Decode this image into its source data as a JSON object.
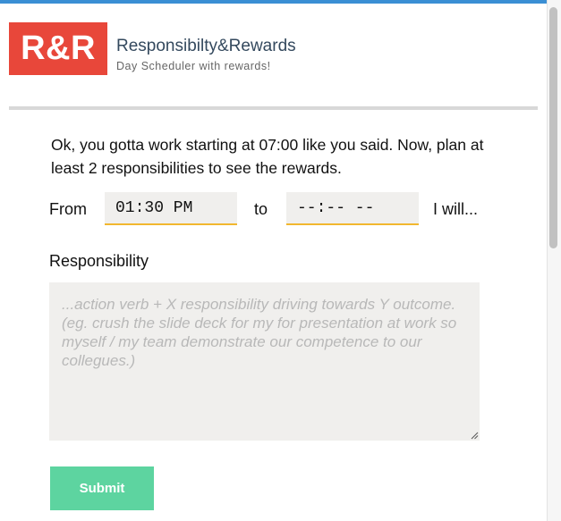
{
  "header": {
    "logo_text": "R&R",
    "title": "Responsibilty&Rewards",
    "subtitle": "Day Scheduler with rewards!",
    "logo_color": "#e8473a",
    "accent_color": "#3a8fd4"
  },
  "main": {
    "instructions": "Ok, you gotta work starting at 07:00 like you said. Now, plan at least 2 responsibilities to see the rewards.",
    "from_label": "From",
    "from_time_value": "01:30 PM",
    "to_label": "to",
    "to_time_value": "--:-- --",
    "will_label": "I will...",
    "responsibility_label": "Responsibility",
    "responsibility_placeholder": "...action verb + X responsibility driving towards Y outcome. (eg. crush the slide deck for my for presentation at work so myself / my team demonstrate our competence to our collegues.)",
    "submit_label": "Submit",
    "submit_color": "#5dd4a0",
    "input_underline_color": "#f2b72f"
  }
}
